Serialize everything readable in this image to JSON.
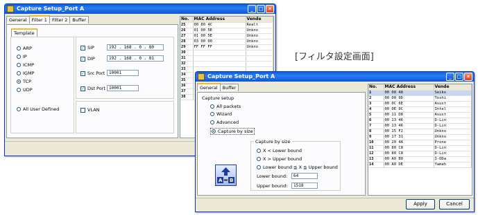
{
  "window1": {
    "title": "Capture Setup_Port A",
    "tabs": [
      "General",
      "Filter 1",
      "Filter 2",
      "Buffer"
    ],
    "template_label": "Template",
    "protocols": [
      "ARP",
      "IP",
      "ICMP",
      "IGMP",
      "TCP",
      "UDP"
    ],
    "selected_protocol": "TCP",
    "all_user_defined": "All User Defined",
    "fields": [
      {
        "label": "SIP",
        "value": "192 . 168 . 0 . 80"
      },
      {
        "label": "DIP",
        "value": "192 . 168 . 0 . 81"
      },
      {
        "label": "Src Port",
        "value": "10001"
      },
      {
        "label": "Dst Port",
        "value": "10001"
      }
    ],
    "vlan_label": "VLAN"
  },
  "caption": "[フィルタ設定画面]",
  "window2": {
    "title": "Capture Setup_Port A",
    "tabs": [
      "General",
      "Buffer"
    ],
    "setup_group": "Capture setup",
    "setup_options": [
      "All packets",
      "Wizard",
      "Advanced",
      "Capture by size"
    ],
    "selected_setup": "Capture by size",
    "size_group": "Capture by size",
    "size_options": [
      "X < Lower bound",
      "X > Upper bound",
      "Lower bound ≦ X ≦ Upper bound"
    ],
    "lower_label": "Lower bound:",
    "lower_value": "64",
    "upper_label": "Upper bound:",
    "upper_value": "1518",
    "icon_letters": [
      "A",
      "B"
    ],
    "apply": "Apply",
    "cancel": "Cancel"
  },
  "mac1": {
    "headers": [
      "No.",
      "MAC Address",
      "Vende"
    ],
    "rows": [
      [
        "25",
        "00 80 4C",
        "Realt"
      ],
      [
        "26",
        "01 00 5E",
        "Unkno"
      ],
      [
        "27",
        "01 00 5E",
        "Unkno"
      ],
      [
        "28",
        "03 00 00",
        "Unkno"
      ],
      [
        "29",
        "FF FF FF",
        "Unkno"
      ],
      [
        "30",
        "",
        ""
      ],
      [
        "31",
        "",
        ""
      ],
      [
        "32",
        "",
        ""
      ],
      [
        "33",
        "",
        ""
      ],
      [
        "34",
        "",
        ""
      ],
      [
        "35",
        "",
        ""
      ],
      [
        "36",
        "",
        ""
      ],
      [
        "37",
        "",
        ""
      ],
      [
        "38",
        "",
        ""
      ]
    ]
  },
  "mac2": {
    "headers": [
      "No.",
      "MAC Address",
      "Vende"
    ],
    "rows": [
      [
        "1",
        "00 00 48",
        "Seiko"
      ],
      [
        "2",
        "00 00 0D",
        "Toshi"
      ],
      [
        "3",
        "00 0C 6E",
        "Asust"
      ],
      [
        "4",
        "00 0E 0C",
        "Intel"
      ],
      [
        "5",
        "00 11 D8",
        "Asust"
      ],
      [
        "6",
        "00 13 46",
        "D-Lin"
      ],
      [
        "7",
        "00 13 46",
        "D-Lin"
      ],
      [
        "8",
        "00 15 F2",
        "Unkno"
      ],
      [
        "9",
        "00 17 31",
        "Unkno"
      ],
      [
        "10",
        "00 20 4A",
        "Prone"
      ],
      [
        "11",
        "00 80 C8",
        "D-Lin"
      ],
      [
        "12",
        "00 80 C8",
        "D-Lin"
      ],
      [
        "13",
        "00 A0 B0",
        "I-ODa"
      ],
      [
        "14",
        "00 A0 DE",
        "Yamah"
      ]
    ]
  }
}
